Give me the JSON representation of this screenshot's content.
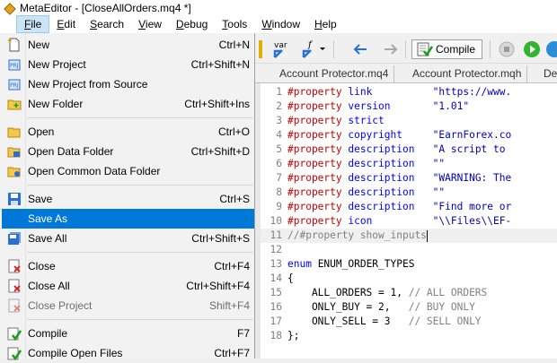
{
  "window": {
    "title": "MetaEditor - [CloseAllOrders.mq4 *]"
  },
  "menubar": [
    {
      "label": "File",
      "accel": "F",
      "rest": "ile"
    },
    {
      "label": "Edit",
      "accel": "E",
      "rest": "dit"
    },
    {
      "label": "Search",
      "accel": "S",
      "rest": "earch"
    },
    {
      "label": "View",
      "accel": "V",
      "rest": "iew"
    },
    {
      "label": "Debug",
      "accel": "D",
      "rest": "ebug"
    },
    {
      "label": "Tools",
      "accel": "T",
      "rest": "ools"
    },
    {
      "label": "Window",
      "accel": "W",
      "rest": "indow"
    },
    {
      "label": "Help",
      "accel": "H",
      "rest": "elp"
    }
  ],
  "file_menu": {
    "items": [
      {
        "label": "New",
        "shortcut": "Ctrl+N",
        "icon": "new-file-icon"
      },
      {
        "label": "New Project",
        "shortcut": "Ctrl+Shift+N",
        "icon": "new-project-icon"
      },
      {
        "label": "New Project from Source",
        "shortcut": "",
        "icon": "project-from-source-icon"
      },
      {
        "label": "New Folder",
        "shortcut": "Ctrl+Shift+Ins",
        "icon": "new-folder-icon"
      },
      {
        "label": "Open",
        "shortcut": "Ctrl+O",
        "icon": "open-folder-icon"
      },
      {
        "label": "Open Data Folder",
        "shortcut": "Ctrl+Shift+D",
        "icon": "data-folder-icon"
      },
      {
        "label": "Open Common Data Folder",
        "shortcut": "",
        "icon": "common-folder-icon"
      },
      {
        "label": "Save",
        "shortcut": "Ctrl+S",
        "icon": "save-icon"
      },
      {
        "label": "Save As",
        "shortcut": "",
        "icon": ""
      },
      {
        "label": "Save All",
        "shortcut": "Ctrl+Shift+S",
        "icon": "save-all-icon"
      },
      {
        "label": "Close",
        "shortcut": "Ctrl+F4",
        "icon": "close-icon"
      },
      {
        "label": "Close All",
        "shortcut": "Ctrl+Shift+F4",
        "icon": "close-all-icon"
      },
      {
        "label": "Close Project",
        "shortcut": "Shift+F4",
        "icon": "close-project-icon"
      },
      {
        "label": "Compile",
        "shortcut": "F7",
        "icon": "compile-icon"
      },
      {
        "label": "Compile Open Files",
        "shortcut": "Ctrl+F7",
        "icon": "compile-all-icon"
      }
    ]
  },
  "toolbar": {
    "compile_label": "Compile"
  },
  "tabs": [
    {
      "label": "Account Protector.mq4"
    },
    {
      "label": "Account Protector.mqh"
    },
    {
      "label": "De"
    }
  ],
  "code_lines": [
    {
      "n": "1",
      "parts": [
        [
          "prop",
          "#property "
        ],
        [
          "kw",
          "link"
        ],
        [
          "plain",
          "          "
        ],
        [
          "str",
          "\"https://www."
        ]
      ]
    },
    {
      "n": "2",
      "parts": [
        [
          "prop",
          "#property "
        ],
        [
          "kw",
          "version"
        ],
        [
          "plain",
          "       "
        ],
        [
          "str",
          "\"1.01\""
        ]
      ]
    },
    {
      "n": "3",
      "parts": [
        [
          "prop",
          "#property "
        ],
        [
          "kw",
          "strict"
        ]
      ]
    },
    {
      "n": "4",
      "parts": [
        [
          "prop",
          "#property "
        ],
        [
          "kw",
          "copyright"
        ],
        [
          "plain",
          "     "
        ],
        [
          "str",
          "\"EarnForex.co"
        ]
      ]
    },
    {
      "n": "5",
      "parts": [
        [
          "prop",
          "#property "
        ],
        [
          "kw",
          "description"
        ],
        [
          "plain",
          "   "
        ],
        [
          "str",
          "\"A script to "
        ]
      ]
    },
    {
      "n": "6",
      "parts": [
        [
          "prop",
          "#property "
        ],
        [
          "kw",
          "description"
        ],
        [
          "plain",
          "   "
        ],
        [
          "str",
          "\"\""
        ]
      ]
    },
    {
      "n": "7",
      "parts": [
        [
          "prop",
          "#property "
        ],
        [
          "kw",
          "description"
        ],
        [
          "plain",
          "   "
        ],
        [
          "str",
          "\"WARNING: The"
        ]
      ]
    },
    {
      "n": "8",
      "parts": [
        [
          "prop",
          "#property "
        ],
        [
          "kw",
          "description"
        ],
        [
          "plain",
          "   "
        ],
        [
          "str",
          "\"\""
        ]
      ]
    },
    {
      "n": "9",
      "parts": [
        [
          "prop",
          "#property "
        ],
        [
          "kw",
          "description"
        ],
        [
          "plain",
          "   "
        ],
        [
          "str",
          "\"Find more or"
        ]
      ]
    },
    {
      "n": "10",
      "parts": [
        [
          "prop",
          "#property "
        ],
        [
          "kw",
          "icon"
        ],
        [
          "plain",
          "          "
        ],
        [
          "str",
          "\"\\\\Files\\\\EF-"
        ]
      ]
    },
    {
      "n": "11",
      "parts": [
        [
          "cmt",
          "//#property show_inputs"
        ]
      ]
    },
    {
      "n": "12",
      "parts": []
    },
    {
      "n": "13",
      "parts": [
        [
          "kw",
          "enum"
        ],
        [
          "plain",
          " ENUM_ORDER_TYPES"
        ]
      ]
    },
    {
      "n": "14",
      "parts": [
        [
          "plain",
          "{"
        ]
      ]
    },
    {
      "n": "15",
      "parts": [
        [
          "plain",
          "    ALL_ORDERS = 1, "
        ],
        [
          "cmt",
          "// ALL ORDERS"
        ]
      ]
    },
    {
      "n": "16",
      "parts": [
        [
          "plain",
          "    ONLY_BUY = 2,   "
        ],
        [
          "cmt",
          "// BUY ONLY"
        ]
      ]
    },
    {
      "n": "17",
      "parts": [
        [
          "plain",
          "    ONLY_SELL = 3   "
        ],
        [
          "cmt",
          "// SELL ONLY"
        ]
      ]
    },
    {
      "n": "18",
      "parts": [
        [
          "plain",
          "};"
        ]
      ]
    }
  ]
}
